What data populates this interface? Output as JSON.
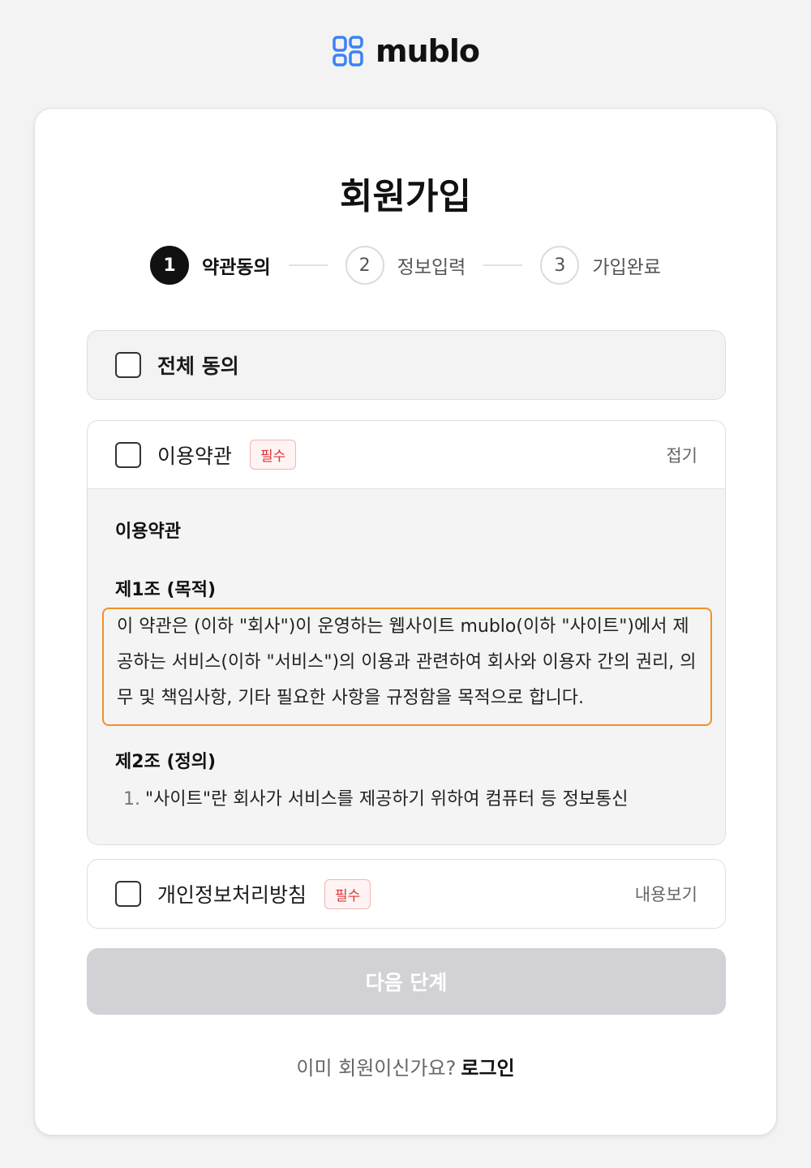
{
  "brand": {
    "name": "mublo",
    "accent": "#3b82f6"
  },
  "page": {
    "title": "회원가입"
  },
  "steps": [
    {
      "number": "1",
      "label": "약관동의",
      "active": true
    },
    {
      "number": "2",
      "label": "정보입력",
      "active": false
    },
    {
      "number": "3",
      "label": "가입완료",
      "active": false
    }
  ],
  "agree_all": {
    "label": "전체 동의",
    "checked": false
  },
  "terms": {
    "label": "이용약관",
    "badge": "필수",
    "action": "접기",
    "checked": false,
    "content": {
      "title": "이용약관",
      "article1_title": "제1조 (목적)",
      "article1_text": "이 약관은 (이하 \"회사\")이 운영하는 웹사이트 mublo(이하 \"사이트\")에서 제공하는 서비스(이하 \"서비스\")의 이용과 관련하여 회사와 이용자 간의 권리, 의무 및 책임사항, 기타 필요한 사항을 규정함을 목적으로 합니다.",
      "article2_title": "제2조 (정의)",
      "article2_item1_num": "1.",
      "article2_item1_text": "\"사이트\"란 회사가 서비스를 제공하기 위하여 컴퓨터 등 정보통신"
    }
  },
  "privacy": {
    "label": "개인정보처리방침",
    "badge": "필수",
    "action": "내용보기",
    "checked": false
  },
  "next_button": {
    "label": "다음 단계",
    "enabled": false
  },
  "login": {
    "prompt": "이미 회원이신가요?",
    "link": "로그인"
  }
}
